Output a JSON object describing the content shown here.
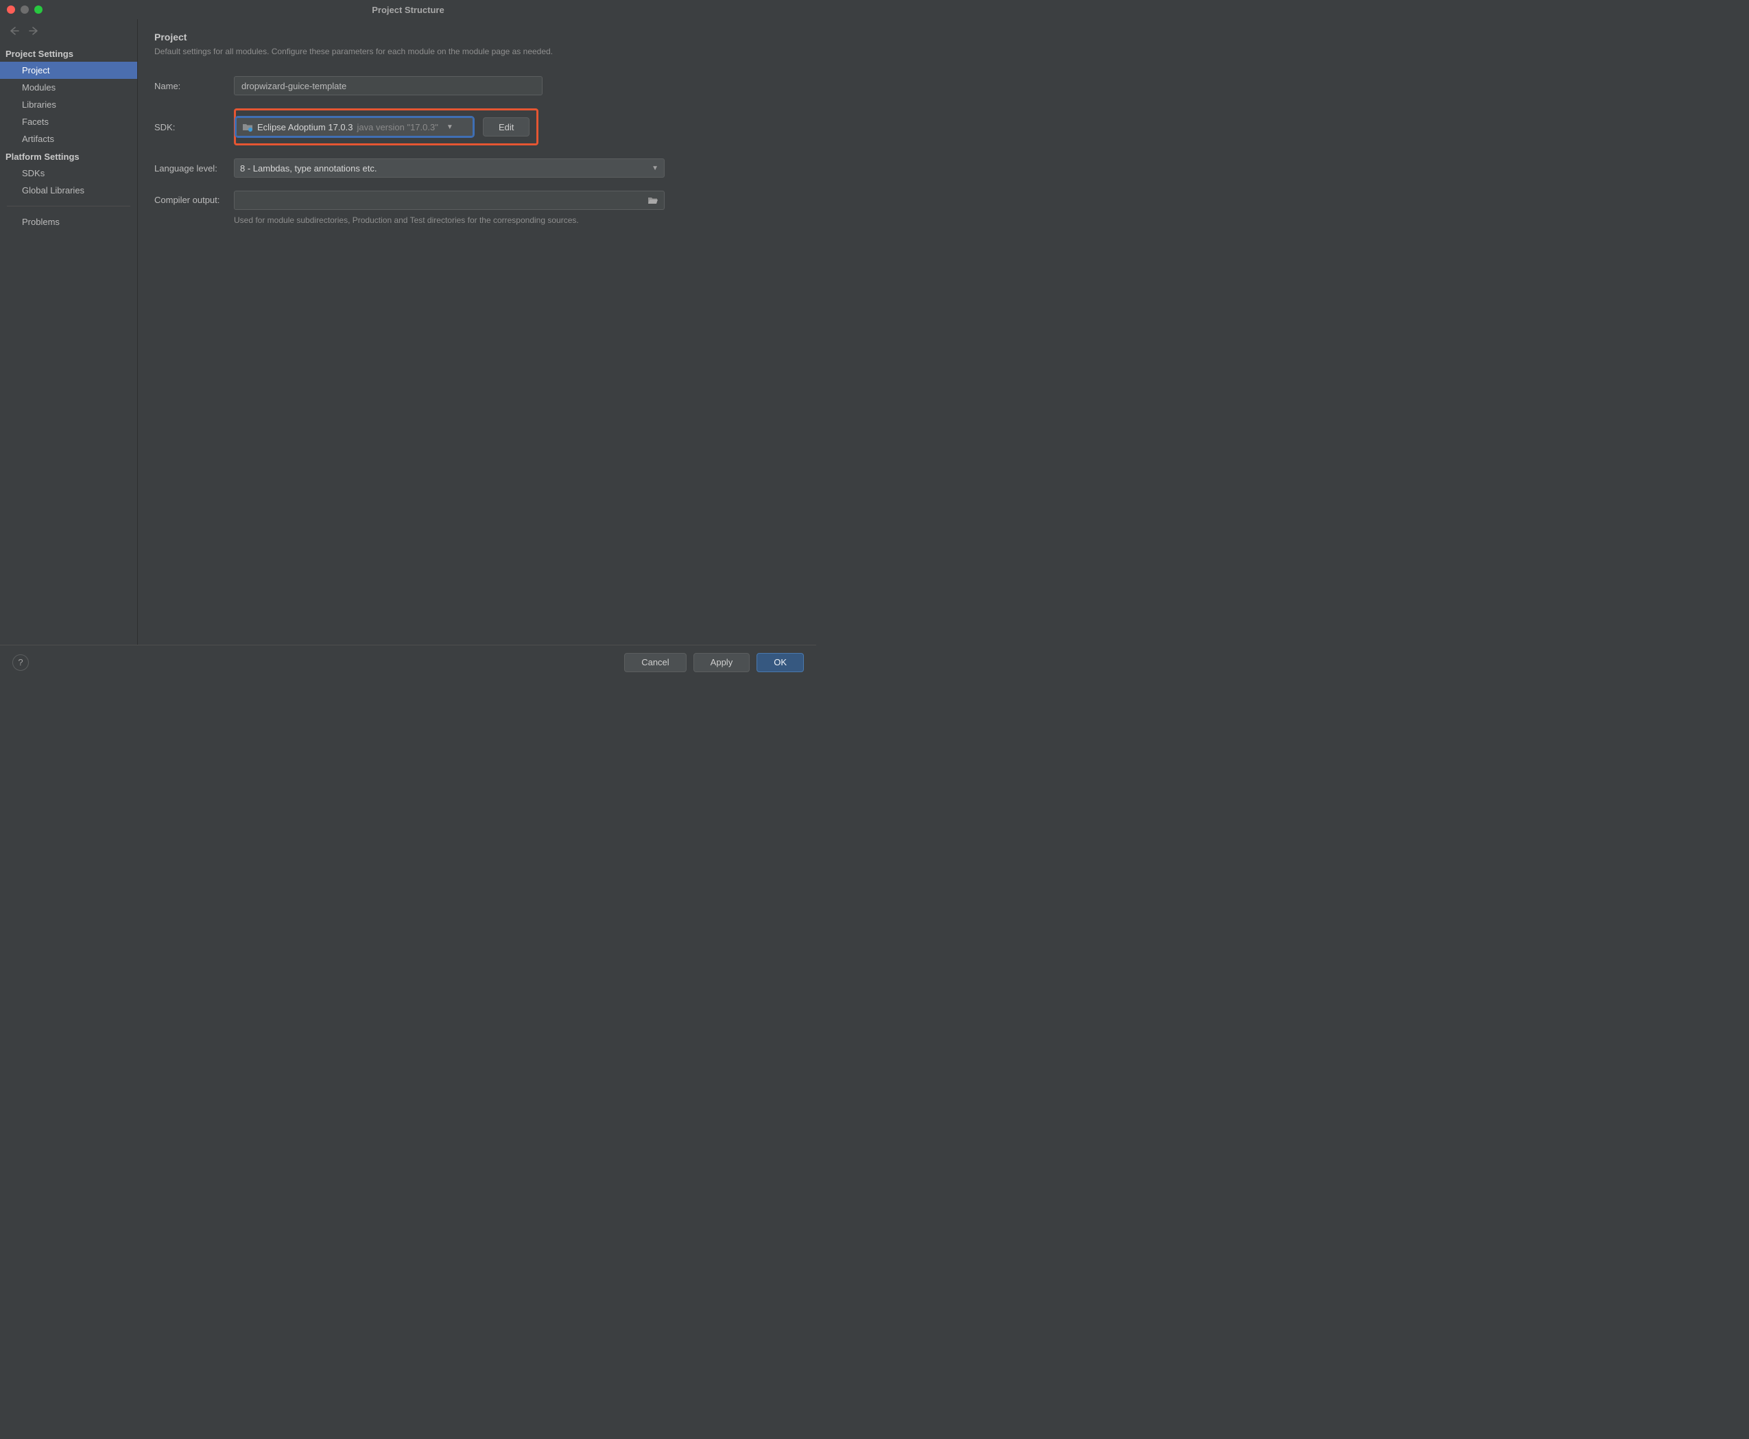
{
  "window": {
    "title": "Project Structure"
  },
  "sidebar": {
    "project_settings_header": "Project Settings",
    "platform_settings_header": "Platform Settings",
    "items": {
      "project": "Project",
      "modules": "Modules",
      "libraries": "Libraries",
      "facets": "Facets",
      "artifacts": "Artifacts",
      "sdks": "SDKs",
      "global_libraries": "Global Libraries",
      "problems": "Problems"
    }
  },
  "content": {
    "heading": "Project",
    "description": "Default settings for all modules. Configure these parameters for each module on the module page as needed.",
    "name_label": "Name:",
    "name_value": "dropwizard-guice-template",
    "sdk_label": "SDK:",
    "sdk_value": "Eclipse Adoptium 17.0.3",
    "sdk_hint": "java version \"17.0.3\"",
    "edit_label": "Edit",
    "lang_label": "Language level:",
    "lang_value": "8 - Lambdas, type annotations etc.",
    "output_label": "Compiler output:",
    "output_help": "Used for module subdirectories, Production and Test directories for the corresponding sources."
  },
  "footer": {
    "help": "?",
    "cancel": "Cancel",
    "apply": "Apply",
    "ok": "OK"
  }
}
